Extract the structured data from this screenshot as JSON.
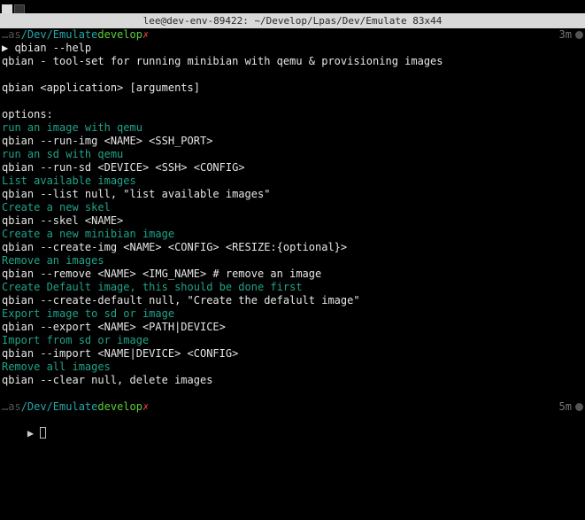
{
  "titlebar": "lee@dev-env-89422: ~/Develop/Lpas/Dev/Emulate 83x44",
  "prompt1": {
    "path_dim": "…as",
    "path": "/Dev/Emulate",
    "branch": "develop",
    "dirty": "✗",
    "time": "3m"
  },
  "cmd": "▶ qbian --help",
  "out": {
    "l1": "qbian - tool-set for running minibian with qemu & provisioning images",
    "l2": "qbian <application> [arguments]",
    "l3": "options:",
    "h1": "run an image with qemu",
    "c1": "qbian --run-img <NAME> <SSH_PORT>",
    "h2": "run an sd with qemu",
    "c2": "qbian --run-sd <DEVICE> <SSH> <CONFIG>",
    "h3": "List available images",
    "c3": "qbian --list null, \"list available images\"",
    "h4": "Create a new skel",
    "c4": "qbian --skel <NAME>",
    "h5": "Create a new minibian image",
    "c5": "qbian --create-img <NAME> <CONFIG> <RESIZE:{optional}>",
    "h6": "Remove an images",
    "c6": "qbian --remove <NAME> <IMG_NAME> # remove an image",
    "h7": "Create Default image, this should be done first",
    "c7": "qbian --create-default null, \"Create the defalult image\"",
    "h8": "Export image to sd or image",
    "c8": "qbian --export <NAME> <PATH|DEVICE>",
    "h9": "Import from sd or image",
    "c9": "qbian --import <NAME|DEVICE> <CONFIG>",
    "h10": "Remove all images",
    "c10": "qbian --clear null, delete images"
  },
  "prompt2": {
    "path_dim": "…as",
    "path": "/Dev/Emulate",
    "branch": "develop",
    "dirty": "✗",
    "time": "5m"
  },
  "caret2": "▶ "
}
